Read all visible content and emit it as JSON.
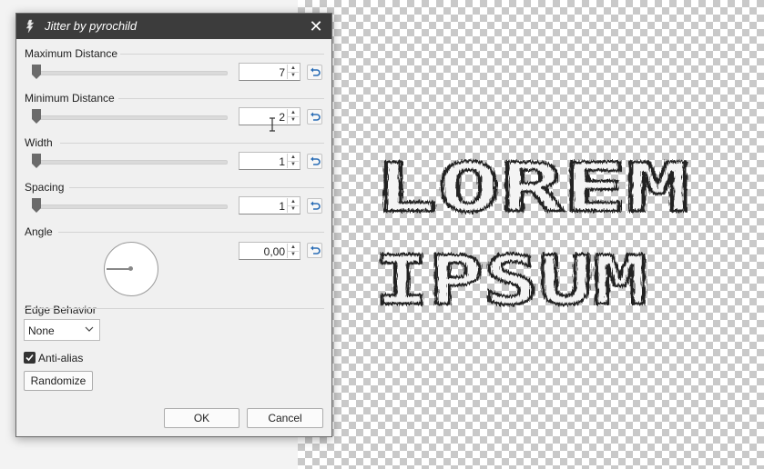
{
  "dialog": {
    "title": "Jitter by pyrochild",
    "close_symbol": "✕"
  },
  "controls": {
    "max_distance": {
      "label": "Maximum Distance",
      "value": "7",
      "slider_fraction": 0.0
    },
    "min_distance": {
      "label": "Minimum Distance",
      "value": "2",
      "slider_fraction": 0.0
    },
    "width": {
      "label": "Width",
      "value": "1",
      "slider_fraction": 0.0
    },
    "spacing": {
      "label": "Spacing",
      "value": "1",
      "slider_fraction": 0.0
    },
    "angle": {
      "label": "Angle",
      "value": "0,00",
      "degrees": 0
    },
    "edge_behavior": {
      "label": "Edge Behavior",
      "value": "None"
    },
    "antialias": {
      "label": "Anti-alias",
      "checked": true
    },
    "randomize_label": "Randomize"
  },
  "footer": {
    "ok_label": "OK",
    "cancel_label": "Cancel"
  },
  "canvas": {
    "line1": "LOREM",
    "line2": "IPSUM"
  },
  "icons": {
    "app": "jitter-app-icon",
    "reset": "reset-arrow-icon",
    "close": "close-icon",
    "checkbox": "checkmark-icon",
    "dropdown": "chevron-down-icon"
  },
  "colors": {
    "titlebar": "#3c3c3c",
    "accent_blue": "#2a6db5",
    "checker_gray": "#c9c9c9"
  }
}
